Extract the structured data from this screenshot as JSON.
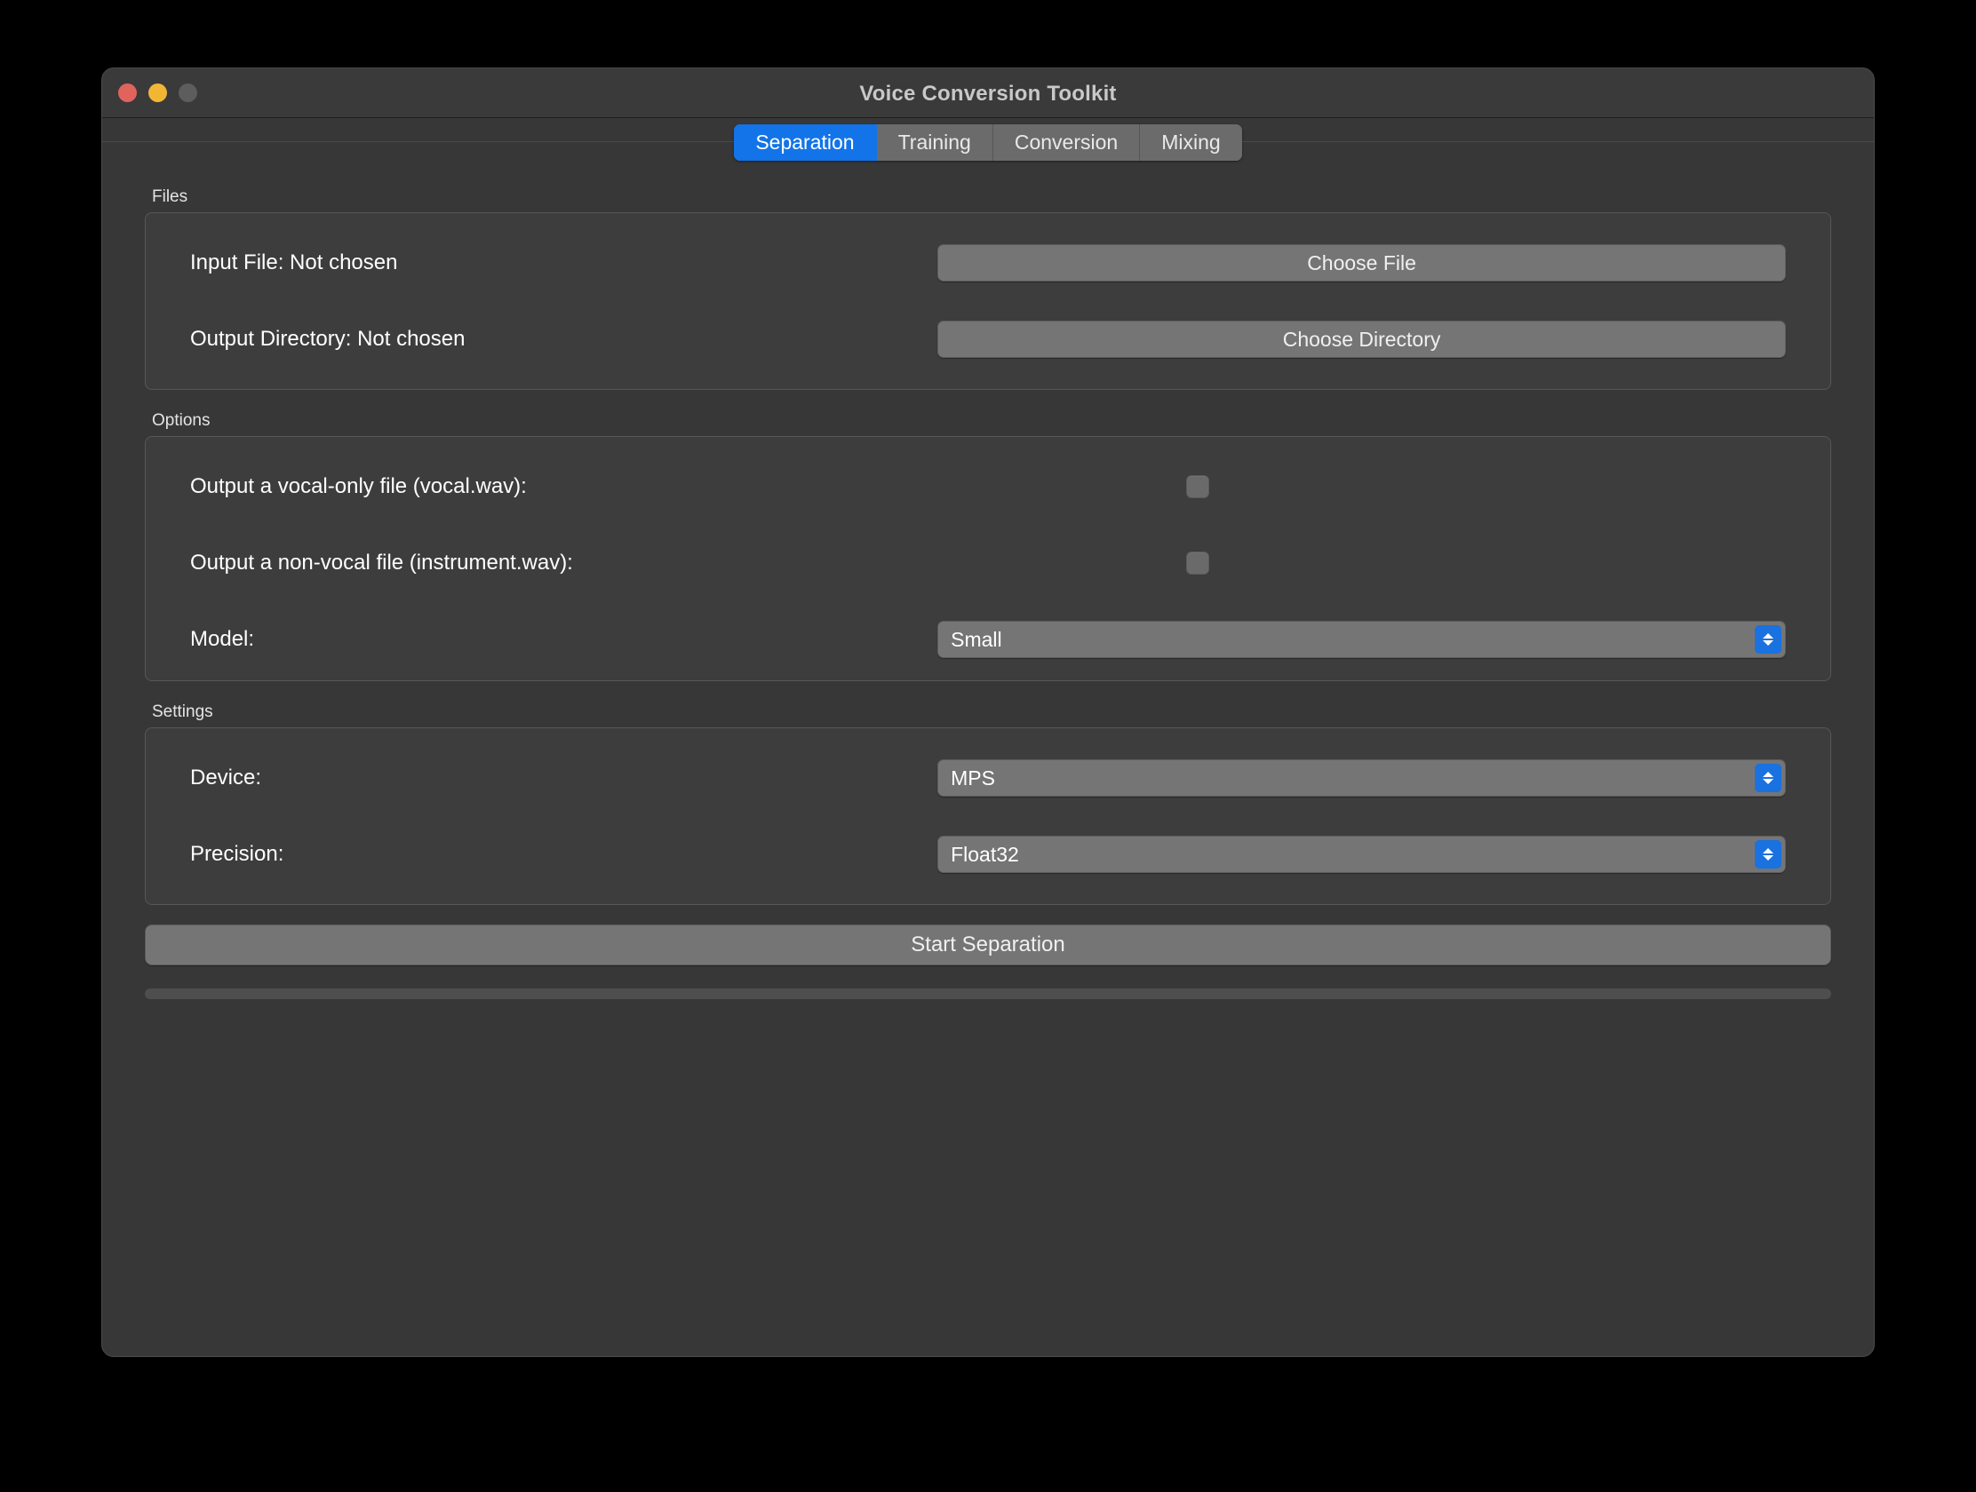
{
  "window": {
    "title": "Voice Conversion Toolkit",
    "traffic_lights": [
      "close-button",
      "minimize-button",
      "zoom-button"
    ],
    "colors": {
      "accent": "#1274e8",
      "close": "#e0645c",
      "minimize": "#f2b635",
      "zoom": "#5d5d5d",
      "window_bg": "#373737",
      "control_bg": "#757575"
    }
  },
  "tabs": [
    {
      "label": "Separation",
      "active": true
    },
    {
      "label": "Training",
      "active": false
    },
    {
      "label": "Conversion",
      "active": false
    },
    {
      "label": "Mixing",
      "active": false
    }
  ],
  "files": {
    "group_label": "Files",
    "input_file_label": "Input File: Not chosen",
    "choose_file_button": "Choose File",
    "output_dir_label": "Output Directory: Not chosen",
    "choose_directory_button": "Choose Directory"
  },
  "options": {
    "group_label": "Options",
    "vocal_only_label": "Output a vocal-only file (vocal.wav):",
    "vocal_only_checked": false,
    "non_vocal_label": "Output a non-vocal file (instrument.wav):",
    "non_vocal_checked": false,
    "model_label": "Model:",
    "model_value": "Small"
  },
  "settings": {
    "group_label": "Settings",
    "device_label": "Device:",
    "device_value": "MPS",
    "precision_label": "Precision:",
    "precision_value": "Float32"
  },
  "actions": {
    "start_button": "Start Separation",
    "progress_percent": 0
  }
}
